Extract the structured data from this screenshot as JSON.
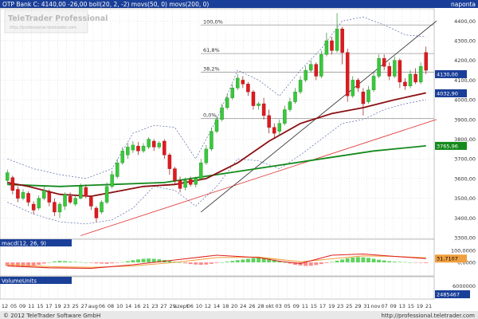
{
  "header": {
    "title": "OTP Bank C: 4140,00 -26,00 boll(20, 2, -2) movs(50, 0) movs(200, 0)",
    "period": "naponta"
  },
  "watermark": {
    "brand": "TeleTrader Professional",
    "url": "http://professional.teletrader.com"
  },
  "footer": {
    "copyright": "© 2012 TeleTrader Software GmbH",
    "url": "http://professional.teletrader.com"
  },
  "colors": {
    "background": "#ffffff",
    "header_bg": "#1a3f98",
    "header_text": "#ffffff",
    "label_bg": "#1a3f98",
    "candle_up": "#39c93c",
    "candle_down": "#e0191f",
    "ma50": "#8b0f12",
    "ma200": "#148a1c",
    "bollinger": "#5b6aa8",
    "trend_black": "#222222",
    "trend_red": "#e04040",
    "macd_line": "#e02020",
    "signal_line": "#f0a040",
    "hist_up": "#5fd35f",
    "hist_down": "#ff8a8a",
    "grid": "#c8c8c8"
  },
  "chart_data": [
    {
      "type": "line",
      "title": "OTP Bank C",
      "subtitle": "4140,00 -26,00",
      "ylim": [
        3300,
        4450
      ],
      "y_ticks": [
        "4400,00",
        "4300,00",
        "4200,00",
        "4100,00",
        "4000,00",
        "3900,00",
        "3800,00",
        "3700,00",
        "3600,00",
        "3500,00",
        "3400,00",
        "3300,00"
      ],
      "x_tick_labels": [
        "12",
        "05",
        "09",
        "11",
        "15",
        "17",
        "19",
        "23",
        "25",
        "27",
        "aug",
        "06",
        "08",
        "10",
        "14",
        "16",
        "21",
        "23",
        "27",
        "29",
        "szept",
        "06",
        "10",
        "12",
        "14",
        "18",
        "20",
        "24",
        "26",
        "28",
        "okt",
        "03",
        "05",
        "09",
        "11",
        "15",
        "17",
        "19",
        "23",
        "25",
        "29",
        "31",
        "nov",
        "07",
        "09",
        "13",
        "15",
        "19",
        "21"
      ],
      "fib_levels": [
        {
          "label": "100,0%",
          "value": 4380
        },
        {
          "label": "61,8%",
          "value": 4235
        },
        {
          "label": "38,2%",
          "value": 4140
        },
        {
          "label": "0,0%",
          "value": 3905
        }
      ],
      "price_labels": [
        "4130,00",
        "4032,90",
        "3765,96"
      ],
      "candles": [
        {
          "o": 3590,
          "c": 3630,
          "h": 3645,
          "l": 3570
        },
        {
          "o": 3605,
          "c": 3540,
          "h": 3615,
          "l": 3520
        },
        {
          "o": 3545,
          "c": 3500,
          "h": 3560,
          "l": 3480
        },
        {
          "o": 3500,
          "c": 3530,
          "h": 3545,
          "l": 3490
        },
        {
          "o": 3525,
          "c": 3480,
          "h": 3535,
          "l": 3460
        },
        {
          "o": 3470,
          "c": 3440,
          "h": 3485,
          "l": 3420
        },
        {
          "o": 3450,
          "c": 3500,
          "h": 3515,
          "l": 3440
        },
        {
          "o": 3500,
          "c": 3540,
          "h": 3560,
          "l": 3490
        },
        {
          "o": 3530,
          "c": 3480,
          "h": 3545,
          "l": 3460
        },
        {
          "o": 3480,
          "c": 3430,
          "h": 3500,
          "l": 3410
        },
        {
          "o": 3430,
          "c": 3470,
          "h": 3480,
          "l": 3400
        },
        {
          "o": 3460,
          "c": 3520,
          "h": 3530,
          "l": 3440
        },
        {
          "o": 3510,
          "c": 3480,
          "h": 3530,
          "l": 3470
        },
        {
          "o": 3470,
          "c": 3500,
          "h": 3515,
          "l": 3460
        },
        {
          "o": 3500,
          "c": 3560,
          "h": 3575,
          "l": 3495
        },
        {
          "o": 3555,
          "c": 3510,
          "h": 3570,
          "l": 3500
        },
        {
          "o": 3505,
          "c": 3460,
          "h": 3515,
          "l": 3440
        },
        {
          "o": 3450,
          "c": 3400,
          "h": 3460,
          "l": 3380
        },
        {
          "o": 3430,
          "c": 3480,
          "h": 3490,
          "l": 3420
        },
        {
          "o": 3480,
          "c": 3560,
          "h": 3580,
          "l": 3470
        },
        {
          "o": 3560,
          "c": 3620,
          "h": 3640,
          "l": 3550
        },
        {
          "o": 3610,
          "c": 3680,
          "h": 3700,
          "l": 3600
        },
        {
          "o": 3680,
          "c": 3740,
          "h": 3760,
          "l": 3670
        },
        {
          "o": 3720,
          "c": 3760,
          "h": 3780,
          "l": 3700
        },
        {
          "o": 3745,
          "c": 3770,
          "h": 3790,
          "l": 3730
        },
        {
          "o": 3765,
          "c": 3740,
          "h": 3785,
          "l": 3720
        },
        {
          "o": 3740,
          "c": 3765,
          "h": 3780,
          "l": 3730
        },
        {
          "o": 3760,
          "c": 3800,
          "h": 3810,
          "l": 3750
        },
        {
          "o": 3790,
          "c": 3760,
          "h": 3800,
          "l": 3740
        },
        {
          "o": 3760,
          "c": 3780,
          "h": 3790,
          "l": 3750
        },
        {
          "o": 3790,
          "c": 3720,
          "h": 3800,
          "l": 3700
        },
        {
          "o": 3720,
          "c": 3650,
          "h": 3730,
          "l": 3620
        },
        {
          "o": 3650,
          "c": 3590,
          "h": 3660,
          "l": 3570
        },
        {
          "o": 3590,
          "c": 3550,
          "h": 3610,
          "l": 3530
        },
        {
          "o": 3555,
          "c": 3590,
          "h": 3605,
          "l": 3540
        },
        {
          "o": 3595,
          "c": 3570,
          "h": 3610,
          "l": 3560
        },
        {
          "o": 3570,
          "c": 3600,
          "h": 3610,
          "l": 3555
        },
        {
          "o": 3600,
          "c": 3680,
          "h": 3700,
          "l": 3590
        },
        {
          "o": 3680,
          "c": 3750,
          "h": 3770,
          "l": 3670
        },
        {
          "o": 3750,
          "c": 3840,
          "h": 3860,
          "l": 3740
        },
        {
          "o": 3840,
          "c": 3900,
          "h": 3920,
          "l": 3830
        },
        {
          "o": 3900,
          "c": 3960,
          "h": 3980,
          "l": 3890
        },
        {
          "o": 3960,
          "c": 4010,
          "h": 4030,
          "l": 3950
        },
        {
          "o": 4010,
          "c": 4060,
          "h": 4080,
          "l": 4000
        },
        {
          "o": 4060,
          "c": 4110,
          "h": 4130,
          "l": 4050
        },
        {
          "o": 4100,
          "c": 4080,
          "h": 4120,
          "l": 4060
        },
        {
          "o": 4080,
          "c": 4040,
          "h": 4090,
          "l": 4020
        },
        {
          "o": 4040,
          "c": 3970,
          "h": 4050,
          "l": 3950
        },
        {
          "o": 3970,
          "c": 3980,
          "h": 3990,
          "l": 3950
        },
        {
          "o": 3980,
          "c": 3920,
          "h": 4010,
          "l": 3900
        },
        {
          "o": 3920,
          "c": 3860,
          "h": 3950,
          "l": 3830
        },
        {
          "o": 3860,
          "c": 3830,
          "h": 3880,
          "l": 3800
        },
        {
          "o": 3840,
          "c": 3880,
          "h": 3900,
          "l": 3820
        },
        {
          "o": 3880,
          "c": 3950,
          "h": 3970,
          "l": 3870
        },
        {
          "o": 3950,
          "c": 3990,
          "h": 4010,
          "l": 3940
        },
        {
          "o": 3990,
          "c": 4040,
          "h": 4060,
          "l": 3980
        },
        {
          "o": 4040,
          "c": 4100,
          "h": 4120,
          "l": 4030
        },
        {
          "o": 4100,
          "c": 4150,
          "h": 4170,
          "l": 4090
        },
        {
          "o": 4150,
          "c": 4180,
          "h": 4200,
          "l": 4140
        },
        {
          "o": 4180,
          "c": 4120,
          "h": 4190,
          "l": 4100
        },
        {
          "o": 4120,
          "c": 4230,
          "h": 4250,
          "l": 4110
        },
        {
          "o": 4230,
          "c": 4300,
          "h": 4340,
          "l": 4220
        },
        {
          "o": 4300,
          "c": 4250,
          "h": 4320,
          "l": 4230
        },
        {
          "o": 4250,
          "c": 4360,
          "h": 4440,
          "l": 4240
        },
        {
          "o": 4360,
          "c": 4240,
          "h": 4370,
          "l": 4180
        },
        {
          "o": 4240,
          "c": 4020,
          "h": 4260,
          "l": 3990
        },
        {
          "o": 4020,
          "c": 4100,
          "h": 4120,
          "l": 4010
        },
        {
          "o": 4100,
          "c": 4060,
          "h": 4110,
          "l": 4040
        },
        {
          "o": 4040,
          "c": 3980,
          "h": 4060,
          "l": 3920
        },
        {
          "o": 3990,
          "c": 4050,
          "h": 4070,
          "l": 3980
        },
        {
          "o": 4050,
          "c": 4120,
          "h": 4140,
          "l": 4040
        },
        {
          "o": 4120,
          "c": 4210,
          "h": 4230,
          "l": 4110
        },
        {
          "o": 4210,
          "c": 4170,
          "h": 4230,
          "l": 4150
        },
        {
          "o": 4170,
          "c": 4120,
          "h": 4190,
          "l": 4100
        },
        {
          "o": 4120,
          "c": 4200,
          "h": 4220,
          "l": 4110
        },
        {
          "o": 4200,
          "c": 4090,
          "h": 4210,
          "l": 4060
        },
        {
          "o": 4090,
          "c": 4070,
          "h": 4110,
          "l": 4050
        },
        {
          "o": 4070,
          "c": 4130,
          "h": 4150,
          "l": 4060
        },
        {
          "o": 4130,
          "c": 4090,
          "h": 4160,
          "l": 4080
        },
        {
          "o": 4090,
          "c": 4170,
          "h": 4190,
          "l": 4080
        },
        {
          "o": 4240,
          "c": 4150,
          "h": 4270,
          "l": 4130
        }
      ],
      "indicators": {
        "ma50_points": [
          [
            0,
            3580
          ],
          [
            4,
            3560
          ],
          [
            10,
            3520
          ],
          [
            16,
            3510
          ],
          [
            20,
            3530
          ],
          [
            26,
            3560
          ],
          [
            32,
            3570
          ],
          [
            38,
            3600
          ],
          [
            44,
            3680
          ],
          [
            50,
            3790
          ],
          [
            56,
            3880
          ],
          [
            62,
            3930
          ],
          [
            68,
            3960
          ],
          [
            74,
            4000
          ],
          [
            80,
            4035
          ]
        ],
        "ma200_points": [
          [
            0,
            3570
          ],
          [
            10,
            3560
          ],
          [
            20,
            3570
          ],
          [
            30,
            3580
          ],
          [
            40,
            3620
          ],
          [
            50,
            3660
          ],
          [
            60,
            3700
          ],
          [
            70,
            3740
          ],
          [
            80,
            3766
          ]
        ],
        "boll_upper": [
          [
            0,
            3700
          ],
          [
            5,
            3650
          ],
          [
            10,
            3620
          ],
          [
            15,
            3600
          ],
          [
            20,
            3650
          ],
          [
            24,
            3830
          ],
          [
            28,
            3870
          ],
          [
            32,
            3860
          ],
          [
            36,
            3700
          ],
          [
            40,
            3900
          ],
          [
            44,
            4150
          ],
          [
            48,
            4100
          ],
          [
            52,
            4020
          ],
          [
            56,
            4150
          ],
          [
            60,
            4260
          ],
          [
            64,
            4400
          ],
          [
            68,
            4420
          ],
          [
            72,
            4380
          ],
          [
            76,
            4330
          ],
          [
            80,
            4320
          ]
        ],
        "boll_lower": [
          [
            0,
            3480
          ],
          [
            5,
            3420
          ],
          [
            10,
            3380
          ],
          [
            15,
            3370
          ],
          [
            20,
            3390
          ],
          [
            24,
            3450
          ],
          [
            28,
            3560
          ],
          [
            32,
            3540
          ],
          [
            36,
            3460
          ],
          [
            40,
            3560
          ],
          [
            44,
            3700
          ],
          [
            48,
            3690
          ],
          [
            52,
            3650
          ],
          [
            56,
            3720
          ],
          [
            60,
            3800
          ],
          [
            64,
            3880
          ],
          [
            68,
            3900
          ],
          [
            72,
            3950
          ],
          [
            76,
            3980
          ],
          [
            80,
            4000
          ]
        ],
        "trend_black": [
          [
            37,
            3430
          ],
          [
            82,
            4400
          ]
        ],
        "trend_red": [
          [
            14,
            3310
          ],
          [
            82,
            3900
          ]
        ]
      },
      "gridlines": true
    },
    {
      "type": "bar",
      "title": "macd(12, 26, 9)",
      "ylim": [
        -100,
        120
      ],
      "y_ticks": [
        "100,0000",
        "0,0000"
      ],
      "value_label": "31,7107",
      "histogram": [
        -30,
        -35,
        -38,
        -40,
        -36,
        -30,
        -20,
        -10,
        0,
        8,
        12,
        10,
        6,
        4,
        2,
        0,
        -4,
        -8,
        -10,
        -12,
        -8,
        -4,
        2,
        10,
        18,
        25,
        30,
        32,
        30,
        26,
        20,
        14,
        6,
        0,
        -8,
        -14,
        -18,
        -20,
        -18,
        -12,
        -6,
        0,
        6,
        12,
        18,
        24,
        30,
        36,
        40,
        38,
        32,
        22,
        12,
        0,
        -10,
        -20,
        -26,
        -30,
        -28,
        -22,
        -14,
        -6,
        4,
        14,
        24,
        34,
        40,
        44,
        42,
        38,
        30,
        22,
        16,
        10,
        6,
        4,
        2,
        0,
        -2,
        -4,
        -6
      ],
      "macd_line": [
        [
          0,
          -30
        ],
        [
          8,
          -45
        ],
        [
          16,
          -50
        ],
        [
          24,
          -20
        ],
        [
          32,
          20
        ],
        [
          40,
          60
        ],
        [
          48,
          40
        ],
        [
          52,
          10
        ],
        [
          56,
          -10
        ],
        [
          62,
          60
        ],
        [
          68,
          70
        ],
        [
          74,
          50
        ],
        [
          80,
          32
        ]
      ],
      "signal_line": [
        [
          0,
          -20
        ],
        [
          8,
          -35
        ],
        [
          16,
          -42
        ],
        [
          24,
          -30
        ],
        [
          32,
          0
        ],
        [
          40,
          40
        ],
        [
          48,
          45
        ],
        [
          52,
          25
        ],
        [
          56,
          5
        ],
        [
          62,
          30
        ],
        [
          68,
          55
        ],
        [
          74,
          50
        ],
        [
          80,
          38
        ]
      ]
    },
    {
      "type": "area",
      "title": "VolumeUnits",
      "y_ticks": [
        "6000000"
      ],
      "value_label": "2485467"
    }
  ]
}
